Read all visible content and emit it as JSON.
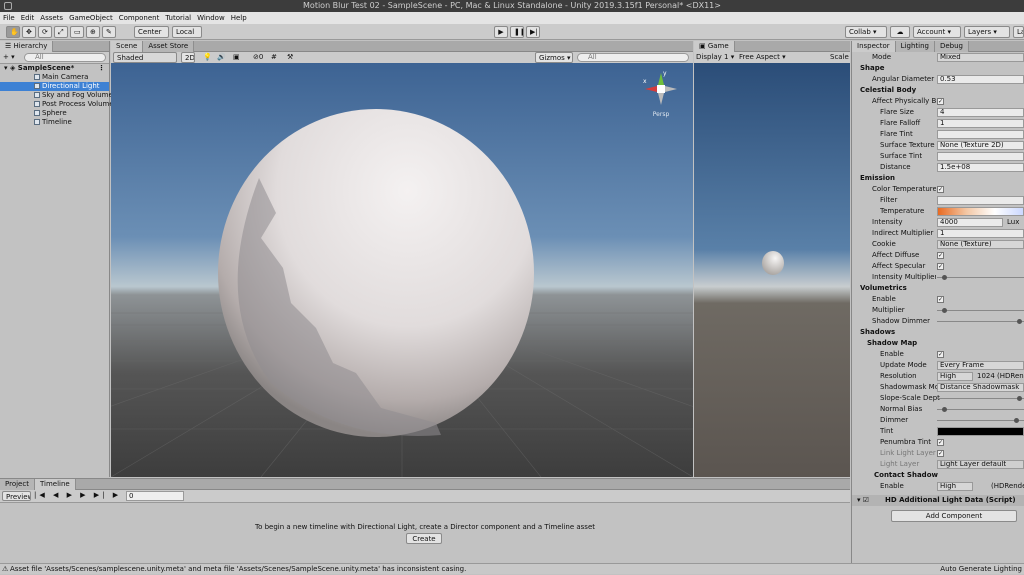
{
  "title": "Motion Blur Test 02 - SampleScene - PC, Mac & Linux Standalone - Unity 2019.3.15f1 Personal* <DX11>",
  "menu": [
    "File",
    "Edit",
    "Assets",
    "GameObject",
    "Component",
    "Tutorial",
    "Window",
    "Help"
  ],
  "toolbar": {
    "center": "Center",
    "local": "Local",
    "collab": "Collab",
    "account": "Account",
    "layers": "Layers",
    "layout": "La"
  },
  "hierarchy": {
    "tab": "Hierarchy",
    "search_placeholder": "All",
    "scene": "SampleScene*",
    "items": [
      "Main Camera",
      "Directional Light",
      "Sky and Fog Volume",
      "Post Process Volume",
      "Sphere",
      "Timeline"
    ]
  },
  "scene": {
    "tabs": [
      "Scene",
      "Asset Store"
    ],
    "shading": "Shaded",
    "mode2d": "2D",
    "fx": "0",
    "gizmos": "Gizmos",
    "search": "All",
    "persp": "Persp"
  },
  "game": {
    "tab": "Game",
    "display": "Display 1",
    "aspect": "Free Aspect",
    "scale": "Scale"
  },
  "inspector": {
    "tabs": [
      "Inspector",
      "Lighting",
      "Debug"
    ],
    "mode_label": "Mode",
    "mode_value": "Mixed",
    "shape": "Shape",
    "angular_label": "Angular Diameter",
    "angular_value": "0.53",
    "celestial": "Celestial Body",
    "celestial_rows": [
      {
        "label": "Affect Physically Ba",
        "value": "check"
      },
      {
        "label": "Flare Size",
        "value": "4"
      },
      {
        "label": "Flare Falloff",
        "value": "1"
      },
      {
        "label": "Flare Tint",
        "value": ""
      },
      {
        "label": "Surface Texture",
        "value": "None (Texture 2D)"
      },
      {
        "label": "Surface Tint",
        "value": ""
      },
      {
        "label": "Distance",
        "value": "1.5e+08"
      }
    ],
    "emission": "Emission",
    "color_temp": "Color Temperature",
    "filter": "Filter",
    "temperature": "Temperature",
    "intensity_label": "Intensity",
    "intensity_value": "4000",
    "intensity_unit": "Lux",
    "indirect_label": "Indirect Multiplier",
    "indirect_value": "1",
    "cookie_label": "Cookie",
    "cookie_value": "None (Texture)",
    "diffuse": "Affect Diffuse",
    "specular": "Affect Specular",
    "intensity_mult": "Intensity Multiplier",
    "volumetrics": "Volumetrics",
    "vol_enable": "Enable",
    "vol_mult": "Multiplier",
    "vol_dimmer": "Shadow Dimmer",
    "shadows": "Shadows",
    "shadow_map": "Shadow Map",
    "sm_enable": "Enable",
    "update_label": "Update Mode",
    "update_value": "Every Frame",
    "res_label": "Resolution",
    "res_value": "High",
    "res_extra": "1024 (HDRende",
    "shadowmask_label": "Shadowmask Mo",
    "shadowmask_value": "Distance Shadowmask",
    "slope": "Slope-Scale Dept",
    "normal_bias": "Normal Bias",
    "dimmer": "Dimmer",
    "tint": "Tint",
    "penumbra": "Penumbra Tint",
    "link_layer": "Link Light Layer",
    "light_layer_label": "Light Layer",
    "light_layer_value": "Light Layer default",
    "contact": "Contact Shadows",
    "cs_enable": "Enable",
    "cs_value": "High",
    "cs_extra": "(HDRende",
    "script": "HD Additional Light Data (Script)",
    "add_component": "Add Component"
  },
  "bottom": {
    "tabs": [
      "Project",
      "Timeline"
    ],
    "preview": "Preview",
    "frame": "0",
    "message": "To begin a new timeline with Directional Light, create a Director component and a Timeline asset",
    "create": "Create"
  },
  "status": {
    "message": "Asset file 'Assets/Scenes/samplescene.unity.meta' and meta file 'Assets/Scenes/SampleScene.unity.meta' has inconsistent casing.",
    "right": "Auto Generate Lighting"
  }
}
